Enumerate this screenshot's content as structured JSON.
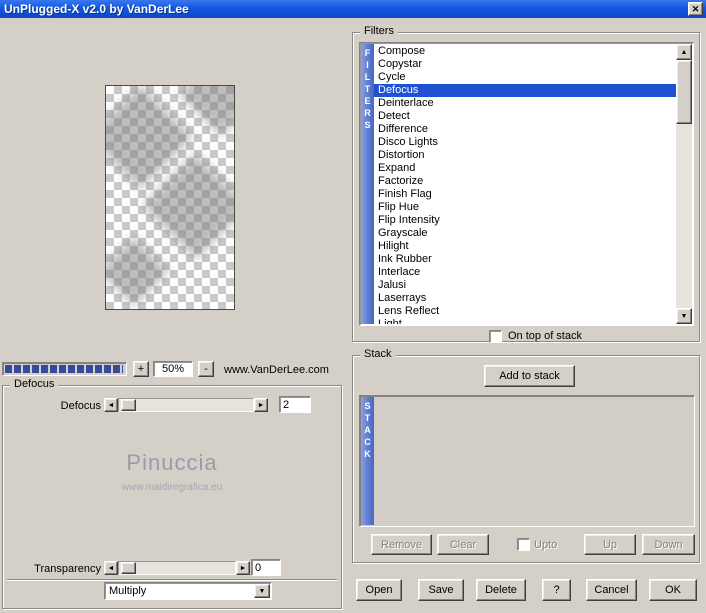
{
  "window": {
    "title": "UnPlugged-X v2.0 by VanDerLee"
  },
  "icons": {
    "close": "✕",
    "up_arrow": "▲",
    "down_arrow": "▼",
    "left_arrow": "◄",
    "right_arrow": "►",
    "dropdown_arrow": "▼"
  },
  "colors": {
    "titlebar_blue": "#1257e0",
    "selection_blue": "#2151d3",
    "strip_blue": "#5d7cd2",
    "progress_blue": "#35499e"
  },
  "preview": {
    "zoom_in": "+",
    "zoom_out": "-",
    "zoom_level": "50%",
    "website": "www.VanDerLee.com"
  },
  "defocus_panel": {
    "title": "Defocus",
    "slider_label": "Defocus",
    "slider_value": "2",
    "watermark_name": "Pinuccia",
    "watermark_site": "www.maidiregrafica.eu",
    "transparency_label": "Transparency",
    "transparency_value": "0",
    "blend_mode": "Multiply"
  },
  "filters_panel": {
    "title": "Filters",
    "strip_text": "FILTERS",
    "selected": "Defocus",
    "items": [
      "Compose",
      "Copystar",
      "Cycle",
      "Defocus",
      "Deinterlace",
      "Detect",
      "Difference",
      "Disco Lights",
      "Distortion",
      "Expand",
      "Factorize",
      "Finish Flag",
      "Flip Hue",
      "Flip Intensity",
      "Grayscale",
      "Hilight",
      "Ink Rubber",
      "Interlace",
      "Jalusi",
      "Laserrays",
      "Lens Reflect",
      "Light"
    ],
    "on_top_checkbox_label": "On top of stack"
  },
  "stack_panel": {
    "title": "Stack",
    "strip_text": "STACK",
    "add_button": "Add to stack",
    "remove_button": "Remove",
    "clear_button": "Clear",
    "upto_checkbox_label": "Upto",
    "up_button": "Up",
    "down_button": "Down"
  },
  "action_buttons": {
    "open": "Open",
    "save": "Save",
    "delete": "Delete",
    "help": "?",
    "cancel": "Cancel",
    "ok": "OK"
  }
}
